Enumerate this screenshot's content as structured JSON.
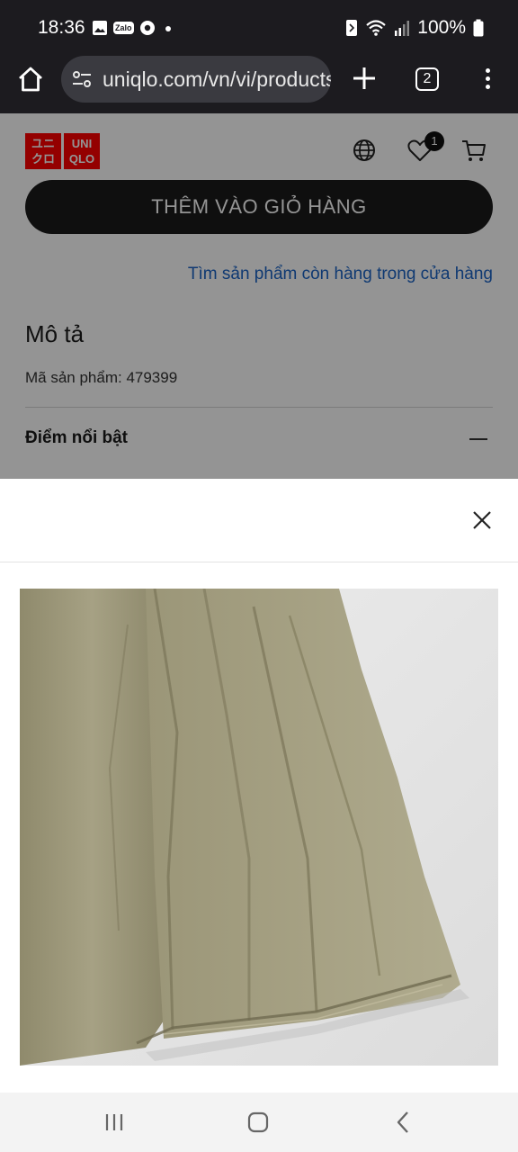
{
  "status_bar": {
    "time": "18:36",
    "notification_icons": [
      "gallery-icon",
      "zalo-icon",
      "chrome-icon",
      "dot-icon"
    ],
    "zalo_label": "Zalo",
    "battery": "100%"
  },
  "browser": {
    "url": "uniqlo.com/vn/vi/products/",
    "tab_count": "2"
  },
  "header": {
    "logo_top": "ユニ\nクロ",
    "logo_bottom": "UNI\nQLO",
    "wishlist_count": "1"
  },
  "page": {
    "add_to_cart": "THÊM VÀO GIỎ HÀNG",
    "find_in_store": "Tìm sản phẩm còn hàng trong cửa hàng",
    "description_title": "Mô tả",
    "sku_label": "Mã sản phẩm: 479399",
    "highlights_label": "Điểm nổi bật"
  },
  "colors": {
    "brand_red": "#ff0000",
    "link_blue": "#1a63c5",
    "button_dark": "#1b1b1b",
    "fabric_olive": "#a39e80"
  }
}
